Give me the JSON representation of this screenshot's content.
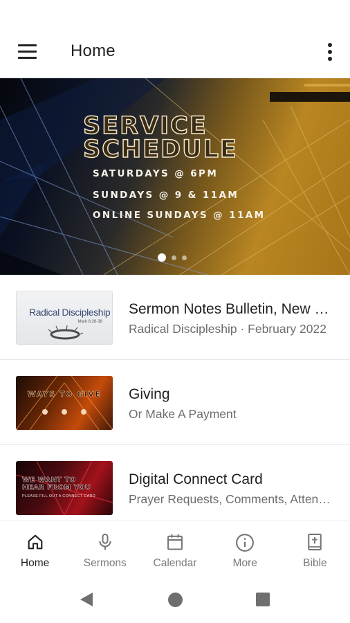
{
  "appbar": {
    "title": "Home",
    "menu_icon": "hamburger-menu-icon",
    "overflow_icon": "more-vert-icon"
  },
  "banner": {
    "title_line1": "SERVICE",
    "title_line2": "SCHEDULE",
    "lines": [
      "SATURDAYS @ 6PM",
      "SUNDAYS @ 9 & 11AM",
      "ONLINE SUNDAYS @ 11AM"
    ],
    "page_count": 3,
    "active_page": 1
  },
  "items": [
    {
      "title": "Sermon Notes Bulletin, New Members",
      "subtitle": "Radical Discipleship · February 2022",
      "thumb_text": "Radical Discipleship",
      "thumb_ref": "Mark 8:28-38"
    },
    {
      "title": "Giving",
      "subtitle": "Or Make A Payment",
      "thumb_text": "WAYS TO GIVE"
    },
    {
      "title": "Digital Connect Card",
      "subtitle": "Prayer Requests, Comments, Attendance",
      "thumb_text_line1": "WE WANT TO",
      "thumb_text_line2": "HEAR FROM YOU",
      "thumb_sub": "PLEASE FILL OUT A CONNECT CARD"
    }
  ],
  "bottom_nav": [
    {
      "label": "Home",
      "icon": "home-icon",
      "active": true
    },
    {
      "label": "Sermons",
      "icon": "microphone-icon",
      "active": false
    },
    {
      "label": "Calendar",
      "icon": "calendar-icon",
      "active": false
    },
    {
      "label": "More",
      "icon": "info-icon",
      "active": false
    },
    {
      "label": "Bible",
      "icon": "bible-icon",
      "active": false
    }
  ],
  "colors": {
    "accent": "#222222",
    "inactive": "#7a7a7a",
    "banner_gold": "#b98622"
  }
}
